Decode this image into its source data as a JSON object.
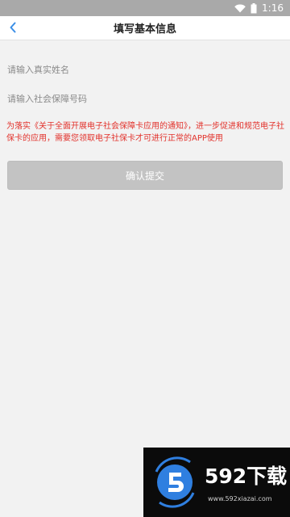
{
  "status_bar": {
    "time": "1:16"
  },
  "nav": {
    "title": "填写基本信息"
  },
  "form": {
    "name_placeholder": "请输入真实姓名",
    "ssn_placeholder": "请输入社会保障号码"
  },
  "notice": {
    "text": "为落实《关于全面开展电子社会保障卡应用的通知》，进一步促进和规范电子社保卡的应用，需要您领取电子社保卡才可进行正常的APP使用"
  },
  "submit": {
    "label": "确认提交"
  },
  "watermark": {
    "brand": "592下载",
    "url": "www.592xiazai.com"
  },
  "colors": {
    "status_bar": "#a9a9a9",
    "nav_bg": "#ffffff",
    "page_bg": "#f2f2f2",
    "back_accent": "#3a8ee6",
    "notice_red": "#e2312b",
    "button_disabled": "#c3c3c3",
    "watermark_bg": "#0b0b0b",
    "logo_blue": "#2f7fe0"
  },
  "icons": {
    "wifi": "wifi-icon",
    "battery": "battery-icon",
    "back": "chevron-left-icon"
  }
}
